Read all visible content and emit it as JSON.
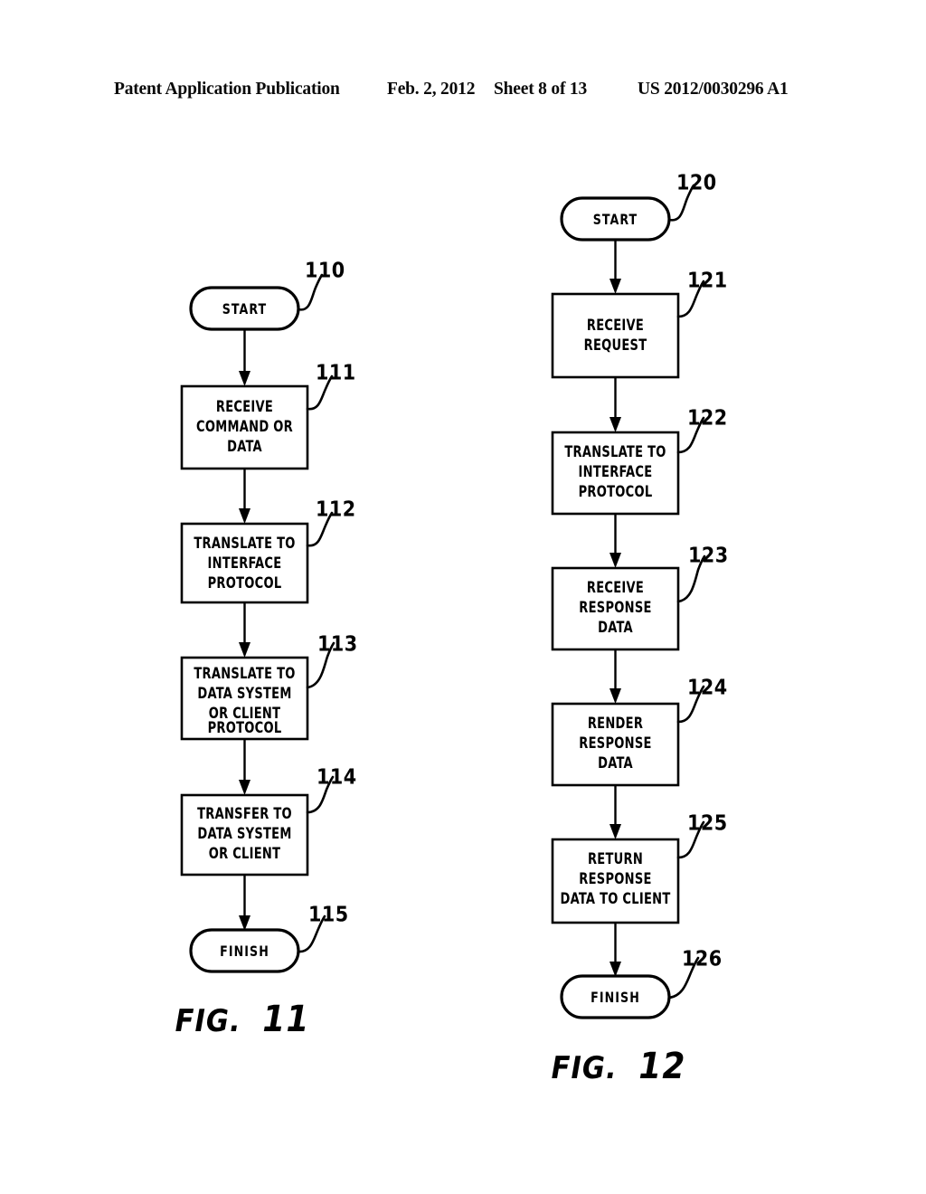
{
  "header": {
    "publication": "Patent Application Publication",
    "date": "Feb. 2, 2012",
    "sheet": "Sheet 8 of 13",
    "doc_number": "US 2012/0030296 A1"
  },
  "figures": [
    {
      "id": "fig-11",
      "caption_prefix": "FIG.",
      "caption_number": "11",
      "nodes": [
        {
          "ref": "110",
          "shape": "terminal",
          "lines": [
            "START"
          ]
        },
        {
          "ref": "111",
          "shape": "process",
          "lines": [
            "RECEIVE",
            "COMMAND OR",
            "DATA"
          ]
        },
        {
          "ref": "112",
          "shape": "process",
          "lines": [
            "TRANSLATE TO",
            "INTERFACE",
            "PROTOCOL"
          ]
        },
        {
          "ref": "113",
          "shape": "process",
          "lines": [
            "TRANSLATE TO",
            "DATA SYSTEM",
            "OR CLIENT",
            "PROTOCOL"
          ]
        },
        {
          "ref": "114",
          "shape": "process",
          "lines": [
            "TRANSFER TO",
            "DATA SYSTEM",
            "OR CLIENT"
          ]
        },
        {
          "ref": "115",
          "shape": "terminal",
          "lines": [
            "FINISH"
          ]
        }
      ]
    },
    {
      "id": "fig-12",
      "caption_prefix": "FIG.",
      "caption_number": "12",
      "nodes": [
        {
          "ref": "120",
          "shape": "terminal",
          "lines": [
            "START"
          ]
        },
        {
          "ref": "121",
          "shape": "process",
          "lines": [
            "RECEIVE",
            "REQUEST"
          ]
        },
        {
          "ref": "122",
          "shape": "process",
          "lines": [
            "TRANSLATE TO",
            "INTERFACE",
            "PROTOCOL"
          ]
        },
        {
          "ref": "123",
          "shape": "process",
          "lines": [
            "RECEIVE",
            "RESPONSE",
            "DATA"
          ]
        },
        {
          "ref": "124",
          "shape": "process",
          "lines": [
            "RENDER",
            "RESPONSE",
            "DATA"
          ]
        },
        {
          "ref": "125",
          "shape": "process",
          "lines": [
            "RETURN",
            "RESPONSE",
            "DATA TO CLIENT"
          ]
        },
        {
          "ref": "126",
          "shape": "terminal",
          "lines": [
            "FINISH"
          ]
        }
      ]
    }
  ],
  "colors": {
    "ink": "#000000",
    "paper": "#ffffff"
  }
}
